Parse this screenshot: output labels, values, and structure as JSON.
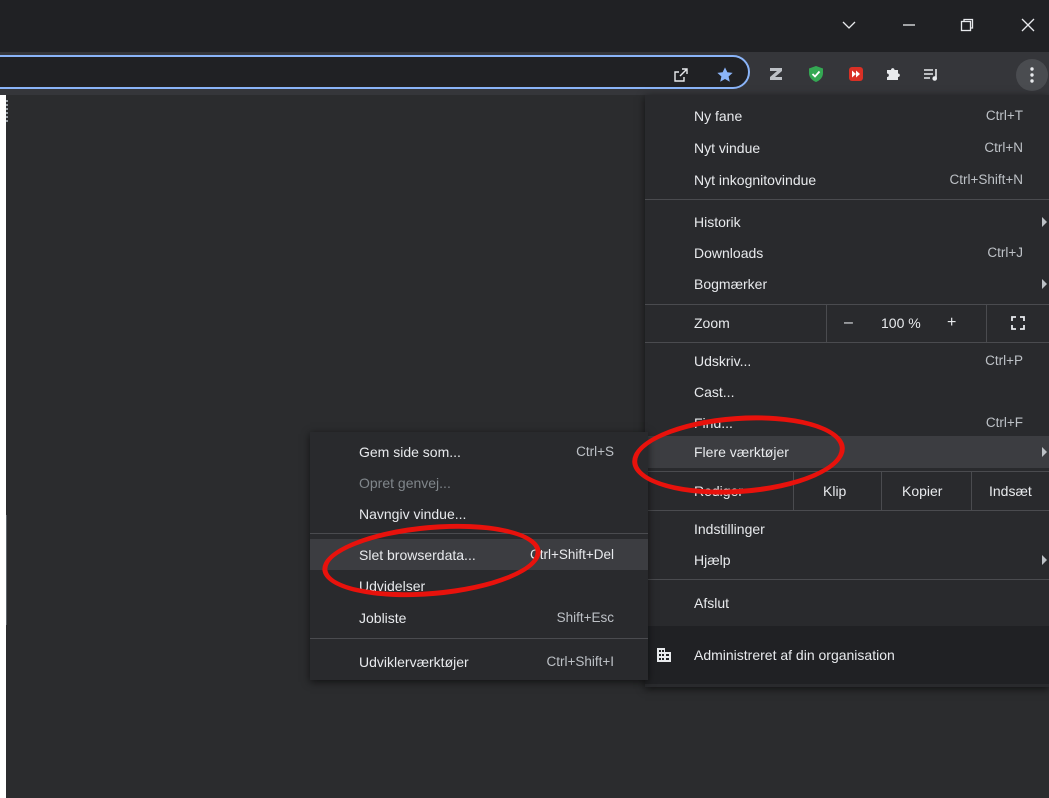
{
  "main_menu": {
    "group1": [
      {
        "label": "Ny fane",
        "shortcut": "Ctrl+T"
      },
      {
        "label": "Nyt vindue",
        "shortcut": "Ctrl+N"
      },
      {
        "label": "Nyt inkognitovindue",
        "shortcut": "Ctrl+Shift+N"
      }
    ],
    "group2": [
      {
        "label": "Historik",
        "submenu": true
      },
      {
        "label": "Downloads",
        "shortcut": "Ctrl+J"
      },
      {
        "label": "Bogmærker",
        "submenu": true
      }
    ],
    "zoom": {
      "label": "Zoom",
      "minus": "–",
      "value": "100 %",
      "plus": "+"
    },
    "group3": [
      {
        "label": "Udskriv...",
        "shortcut": "Ctrl+P"
      },
      {
        "label": "Cast..."
      },
      {
        "label": "Find...",
        "shortcut": "Ctrl+F"
      },
      {
        "label": "Flere værktøjer",
        "submenu": true
      }
    ],
    "edit": {
      "label": "Rediger",
      "cut": "Klip",
      "copy": "Kopier",
      "paste": "Indsæt"
    },
    "group4": [
      {
        "label": "Indstillinger"
      },
      {
        "label": "Hjælp",
        "submenu": true
      }
    ],
    "exit": {
      "label": "Afslut"
    },
    "managed": {
      "label": "Administreret af din organisation"
    }
  },
  "sub_menu": {
    "group1": [
      {
        "label": "Gem side som...",
        "shortcut": "Ctrl+S"
      },
      {
        "label": "Opret genvej...",
        "disabled": true
      },
      {
        "label": "Navngiv vindue..."
      }
    ],
    "group2": [
      {
        "label": "Slet browserdata...",
        "shortcut": "Ctrl+Shift+Del"
      },
      {
        "label": "Udvidelser"
      },
      {
        "label": "Jobliste",
        "shortcut": "Shift+Esc"
      }
    ],
    "group3": [
      {
        "label": "Udviklerværktøjer",
        "shortcut": "Ctrl+Shift+I"
      }
    ]
  },
  "icons": {
    "share": "share-icon",
    "star": "bookmark-star-icon",
    "z_ext": "z-extension-icon",
    "shield_ext": "shield-extension-icon",
    "red_ext": "red-extension-icon",
    "puzzle": "extensions-puzzle-icon",
    "reading_list": "reading-list-icon",
    "menu": "kebab-menu-icon",
    "fullscreen": "fullscreen-icon",
    "building": "building-icon"
  },
  "colors": {
    "annotation_circle": "#e8120c",
    "omnibox_border": "#8ab4f8",
    "star": "#8ab4f8",
    "shield": "#34a853"
  }
}
